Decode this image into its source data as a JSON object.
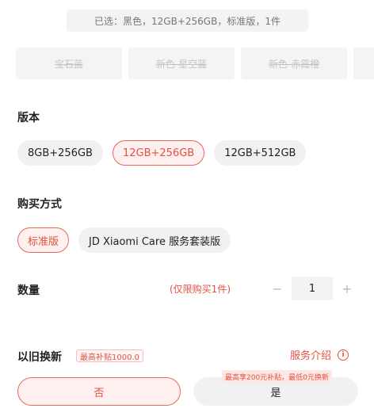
{
  "summary": "已选：黑色，12GB+256GB，标准版，1件",
  "colors": [
    "宝石蓝",
    "新色-星空蓝",
    "新色-赤霞橙",
    ""
  ],
  "version": {
    "title": "版本",
    "options": [
      "8GB+256GB",
      "12GB+256GB",
      "12GB+512GB"
    ],
    "selected_index": 1
  },
  "purchase": {
    "title": "购买方式",
    "options": [
      "标准版",
      "JD Xiaomi Care 服务套装版"
    ],
    "selected_index": 0
  },
  "quantity": {
    "title": "数量",
    "note": "(仅限购买1件)",
    "value": "1",
    "minus": "−",
    "plus": "+"
  },
  "trade_in": {
    "title": "以旧换新",
    "badge": "最高补贴1000.0",
    "service_link": "服务介绍",
    "info_glyph": "i",
    "no_label": "否",
    "yes_label": "是",
    "promo": "最高享200元补贴，最低0元换新"
  },
  "accent_color": "#e25141"
}
